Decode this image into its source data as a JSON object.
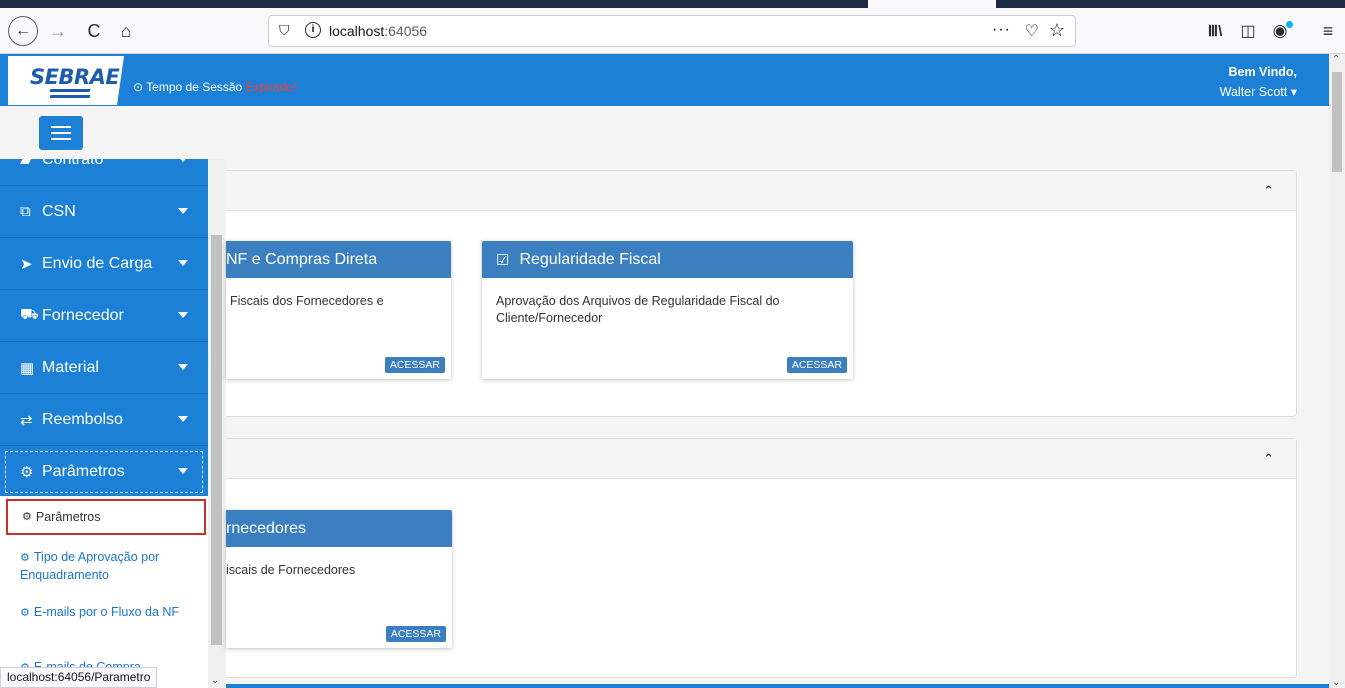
{
  "browser": {
    "url_host": "localhost",
    "url_port": ":64056",
    "back_icon": "←",
    "forward_icon": "→",
    "reload_icon": "C",
    "home_icon": "⌂",
    "more_icon": "···",
    "status_url": "localhost:64056/Parametro"
  },
  "header": {
    "logo": "SEBRAE",
    "session_label": "⊙ Tempo de Sessão ",
    "session_status": "Expirado!",
    "welcome_line1": "Bem Vindo,",
    "welcome_line2": "Walter Scott ▾"
  },
  "sidebar": {
    "items": [
      {
        "label": "Contrato",
        "icon": "contract-icon"
      },
      {
        "label": "CSN",
        "icon": "copy-icon"
      },
      {
        "label": "Envio de Carga",
        "icon": "send-icon"
      },
      {
        "label": "Fornecedor",
        "icon": "truck-icon"
      },
      {
        "label": "Material",
        "icon": "building-icon"
      },
      {
        "label": "Reembolso",
        "icon": "exchange-icon"
      },
      {
        "label": "Parâmetros",
        "icon": "cogs-icon"
      }
    ],
    "submenu": [
      {
        "label": "Parâmetros"
      },
      {
        "label": "Tipo de Aprovação por Enquadramento"
      },
      {
        "label": "E-mails por o Fluxo da NF"
      },
      {
        "label": "E-mails de Compra"
      }
    ]
  },
  "main": {
    "cards": [
      {
        "title": "NF e Compras Direta",
        "description": "Fiscais dos Fornecedores e",
        "button": "ACESSAR"
      },
      {
        "title": "Regularidade Fiscal",
        "description": "Aprovação dos Arquivos de Regularidade Fiscal do Cliente/Fornecedor",
        "button": "ACESSAR"
      },
      {
        "title": "rnecedores",
        "description": "iscais de Fornecedores",
        "button": "ACESSAR"
      }
    ]
  },
  "colors": {
    "primary": "#1b80d6",
    "card_header": "#3c7fc1",
    "expired": "#ff3b30",
    "highlight_border": "#c9302c"
  }
}
